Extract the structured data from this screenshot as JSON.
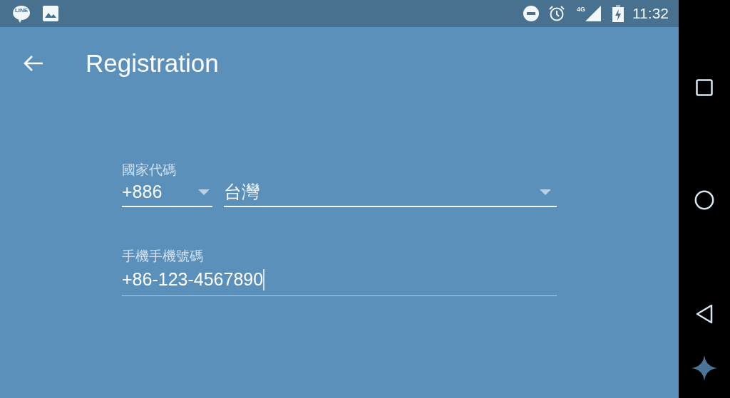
{
  "status_bar": {
    "app_badge": "LINE",
    "network": "4G",
    "time": "11:32"
  },
  "app_bar": {
    "title": "Registration"
  },
  "country": {
    "label": "國家代碼",
    "code": "+886",
    "name": "台灣"
  },
  "phone": {
    "label": "手機手機號碼",
    "value": "+86-123-4567890",
    "focused": true
  }
}
